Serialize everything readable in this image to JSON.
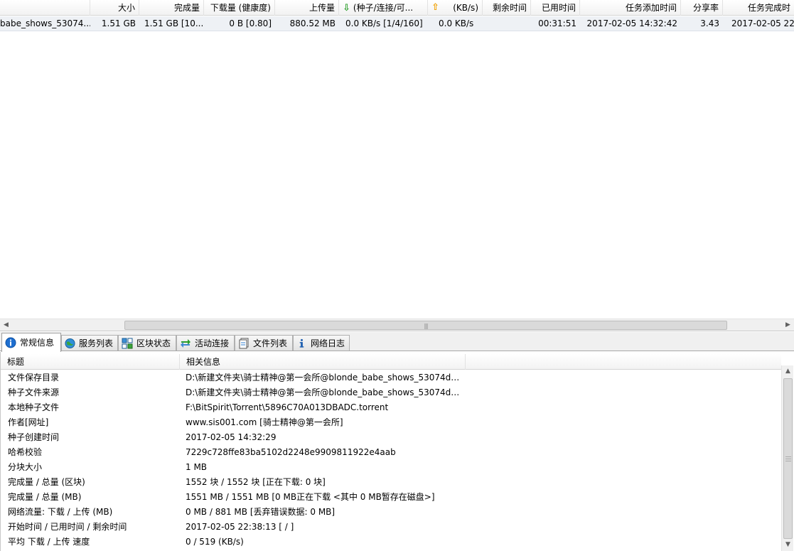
{
  "task_list": {
    "columns": {
      "size": "大小",
      "completed": "完成量",
      "downloaded": "下载量 (健康度)",
      "uploaded": "上传量",
      "peers": "(种子/连接/可...",
      "up_speed": "(KB/s)",
      "remaining": "剩余时间",
      "elapsed": "已用时间",
      "added": "任务添加时间",
      "ratio": "分享率",
      "finished": "任务完成时"
    },
    "row": {
      "name": "babe_shows_53074...",
      "size": "1.51 GB",
      "completed": "1.51 GB [10...",
      "downloaded": "0 B [0.80]",
      "uploaded": "880.52 MB",
      "peers": "0.0 KB/s [1/4/160]",
      "up_speed": "0.0 KB/s",
      "remaining": "",
      "elapsed": "00:31:51",
      "added": "2017-02-05 14:32:42",
      "ratio": "3.43",
      "finished": "2017-02-05 22:"
    }
  },
  "tabs": [
    {
      "label": "常规信息",
      "icon": "info-icon",
      "active": true
    },
    {
      "label": "服务列表",
      "icon": "globe-icon"
    },
    {
      "label": "区块状态",
      "icon": "blocks-icon"
    },
    {
      "label": "活动连接",
      "icon": "connections-icon"
    },
    {
      "label": "文件列表",
      "icon": "files-icon"
    },
    {
      "label": "网络日志",
      "icon": "log-icon"
    }
  ],
  "detail": {
    "headers": {
      "title": "标题",
      "info": "相关信息"
    },
    "rows": [
      {
        "k": "文件保存目录",
        "v": "D:\\新建文件夹\\骑士精神@第一会所@blonde_babe_shows_53074d1..."
      },
      {
        "k": "种子文件来源",
        "v": "D:\\新建文件夹\\骑士精神@第一会所@blonde_babe_shows_53074d1..."
      },
      {
        "k": "本地种子文件",
        "v": "F:\\BitSpirit\\Torrent\\5896C70A013DBADC.torrent"
      },
      {
        "k": "作者[网址]",
        "v": "www.sis001.com [骑士精神@第一会所]"
      },
      {
        "k": "种子创建时间",
        "v": "2017-02-05 14:32:29"
      },
      {
        "k": "哈希校验",
        "v": "7229c728ffe83ba5102d2248e9909811922e4aab"
      },
      {
        "k": "分块大小",
        "v": "1 MB"
      },
      {
        "k": "完成量 / 总量 (区块)",
        "v": "1552 块 / 1552 块 [正在下载: 0 块]"
      },
      {
        "k": "完成量 / 总量 (MB)",
        "v": "1551 MB / 1551 MB [0 MB正在下载 <其中 0 MB暂存在磁盘>]"
      },
      {
        "k": "网络流量: 下载 / 上传 (MB)",
        "v": "0 MB / 881 MB [丢弃错误数据: 0 MB]"
      },
      {
        "k": "开始时间 / 已用时间 / 剩余时间",
        "v": "2017-02-05 22:38:13 [ / ]"
      },
      {
        "k": "平均 下载 / 上传 速度",
        "v": "0 / 519 (KB/s)"
      }
    ]
  },
  "colors": {
    "row_highlight": "#eef1f5",
    "down_arrow": "#2c9f2c",
    "up_arrow": "#f0a000",
    "info_blue": "#1e6fd0"
  }
}
